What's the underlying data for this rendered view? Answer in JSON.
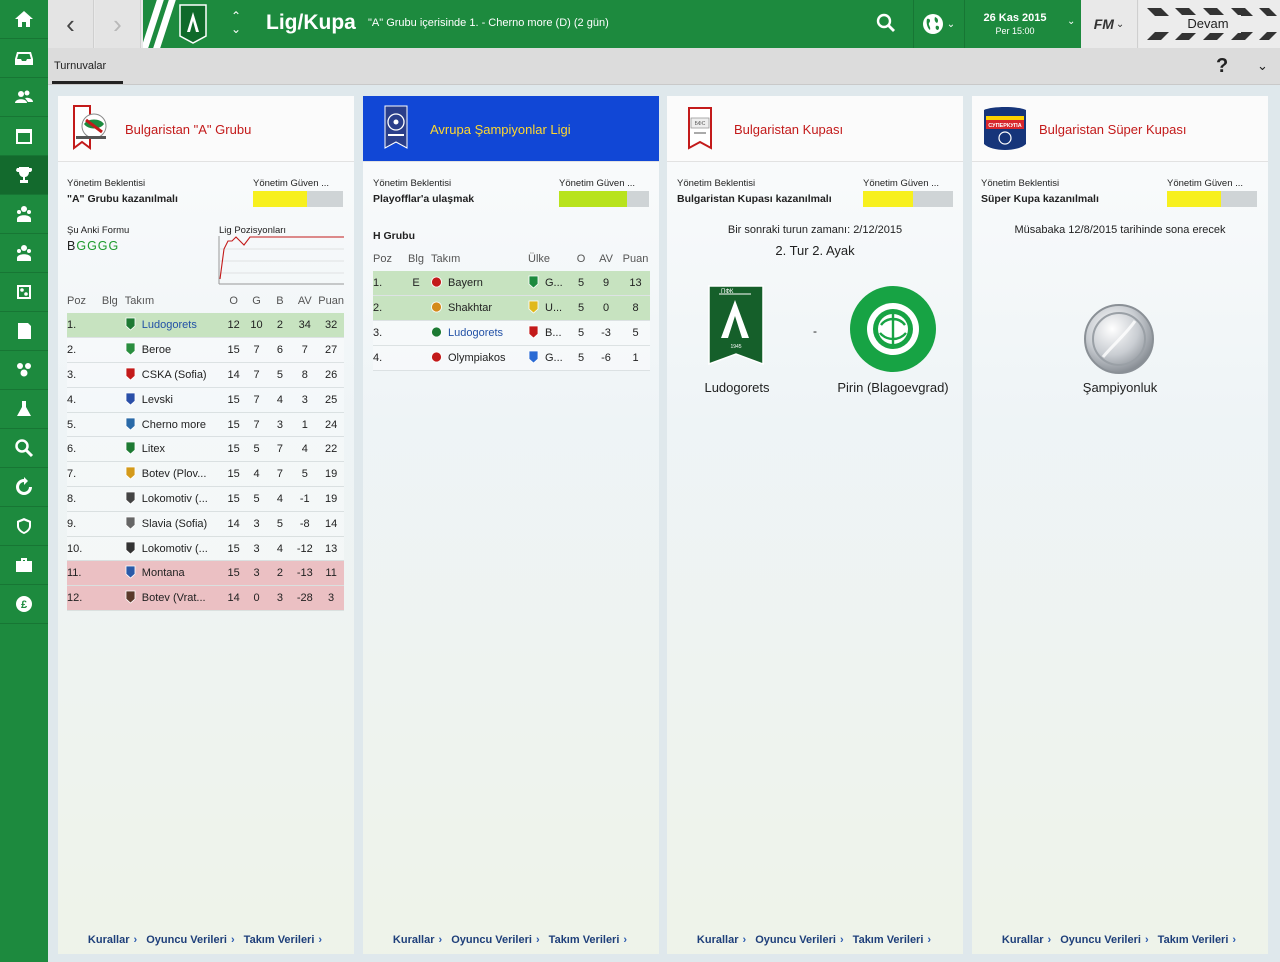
{
  "topbar": {
    "title": "Lig/Kupa",
    "subtitle": "\"A\" Grubu içerisinde 1. - Cherno more (D) (2 gün)",
    "date": "26 Kas 2015",
    "time": "Per 15:00",
    "fm_label": "FM",
    "continue_label": "Devam"
  },
  "subbar": {
    "tab_label": "Turnuvalar"
  },
  "colors": {
    "green": "#1d8a3e",
    "blue_header": "#1147d6",
    "red_title": "#c31a1a",
    "yellow": "#f7f01e",
    "lime": "#b8e31c",
    "promo": "#c7e3c0",
    "releg": "#ebc0c3"
  },
  "sidebar": {
    "items": [
      {
        "icon": "home-icon"
      },
      {
        "icon": "inbox-icon"
      },
      {
        "icon": "squad-icon"
      },
      {
        "icon": "calendar-icon"
      },
      {
        "icon": "trophy-icon"
      },
      {
        "icon": "staff-icon"
      },
      {
        "icon": "youth-icon"
      },
      {
        "icon": "tactics-icon"
      },
      {
        "icon": "reports-icon"
      },
      {
        "icon": "training-icon"
      },
      {
        "icon": "medical-icon"
      },
      {
        "icon": "scouting-icon"
      },
      {
        "icon": "transfers-icon"
      },
      {
        "icon": "club-icon"
      },
      {
        "icon": "briefcase-icon"
      },
      {
        "icon": "finances-icon"
      }
    ]
  },
  "common": {
    "board_expectation_label": "Yönetim Beklentisi",
    "board_confidence_label": "Yönetim Güven ...",
    "footer": {
      "rules": "Kurallar",
      "player_stats": "Oyuncu Verileri",
      "team_stats": "Takım Verileri"
    }
  },
  "panel1": {
    "title": "Bulgaristan \"A\" Grubu",
    "expectation": "\"A\" Grubu kazanılmalı",
    "confidence": 0.6,
    "form_label": "Şu Anki Formu",
    "form_first": "B",
    "form_rest": "GGGG",
    "positions_label": "Lig Pozisyonları",
    "headers": {
      "pos": "Poz",
      "info": "Blg",
      "team": "Takım",
      "played": "O",
      "won": "G",
      "drawn": "B",
      "gd": "AV",
      "pts": "Puan"
    },
    "rows": [
      {
        "pos": "1.",
        "team": "Ludogorets",
        "o": "12",
        "g": "10",
        "b": "2",
        "av": "34",
        "p": "32"
      },
      {
        "pos": "2.",
        "team": "Beroe",
        "o": "15",
        "g": "7",
        "b": "6",
        "av": "7",
        "p": "27"
      },
      {
        "pos": "3.",
        "team": "CSKA (Sofia)",
        "o": "14",
        "g": "7",
        "b": "5",
        "av": "8",
        "p": "26"
      },
      {
        "pos": "4.",
        "team": "Levski",
        "o": "15",
        "g": "7",
        "b": "4",
        "av": "3",
        "p": "25"
      },
      {
        "pos": "5.",
        "team": "Cherno more",
        "o": "15",
        "g": "7",
        "b": "3",
        "av": "1",
        "p": "24"
      },
      {
        "pos": "6.",
        "team": "Litex",
        "o": "15",
        "g": "5",
        "b": "7",
        "av": "4",
        "p": "22"
      },
      {
        "pos": "7.",
        "team": "Botev (Plov...",
        "o": "15",
        "g": "4",
        "b": "7",
        "av": "5",
        "p": "19"
      },
      {
        "pos": "8.",
        "team": "Lokomotiv (...",
        "o": "15",
        "g": "5",
        "b": "4",
        "av": "-1",
        "p": "19"
      },
      {
        "pos": "9.",
        "team": "Slavia (Sofia)",
        "o": "14",
        "g": "3",
        "b": "5",
        "av": "-8",
        "p": "14"
      },
      {
        "pos": "10.",
        "team": "Lokomotiv (...",
        "o": "15",
        "g": "3",
        "b": "4",
        "av": "-12",
        "p": "13"
      },
      {
        "pos": "11.",
        "team": "Montana",
        "o": "15",
        "g": "3",
        "b": "2",
        "av": "-13",
        "p": "11"
      },
      {
        "pos": "12.",
        "team": "Botev (Vrat...",
        "o": "14",
        "g": "0",
        "b": "3",
        "av": "-28",
        "p": "3"
      }
    ]
  },
  "panel2": {
    "title": "Avrupa Şampiyonlar Ligi",
    "expectation": "Playofflar'a ulaşmak",
    "confidence": 0.75,
    "group_label": "H Grubu",
    "headers": {
      "pos": "Poz",
      "info": "Blg",
      "team": "Takım",
      "country": "Ülke",
      "played": "O",
      "gd": "AV",
      "pts": "Puan"
    },
    "rows": [
      {
        "pos": "1.",
        "info": "E",
        "team": "Bayern",
        "country": "G...",
        "o": "5",
        "av": "9",
        "p": "13"
      },
      {
        "pos": "2.",
        "info": "",
        "team": "Shakhtar",
        "country": "U...",
        "o": "5",
        "av": "0",
        "p": "8"
      },
      {
        "pos": "3.",
        "info": "",
        "team": "Ludogorets",
        "country": "B...",
        "o": "5",
        "av": "-3",
        "p": "5"
      },
      {
        "pos": "4.",
        "info": "",
        "team": "Olympiakos",
        "country": "G...",
        "o": "5",
        "av": "-6",
        "p": "1"
      }
    ]
  },
  "panel3": {
    "title": "Bulgaristan Kupası",
    "expectation": "Bulgaristan Kupası kazanılmalı",
    "confidence": 0.55,
    "next_round": "Bir sonraki turun zamanı: 2/12/2015",
    "round": "2. Tur 2. Ayak",
    "home_team": "Ludogorets",
    "away_team": "Pirin (Blagoevgrad)",
    "separator": "-"
  },
  "panel4": {
    "title": "Bulgaristan Süper Kupası",
    "expectation": "Süper Kupa kazanılmalı",
    "confidence": 0.6,
    "ended_text": "Müsabaka 12/8/2015 tarihinde sona erecek",
    "trophy_label": "Şampiyonluk"
  }
}
